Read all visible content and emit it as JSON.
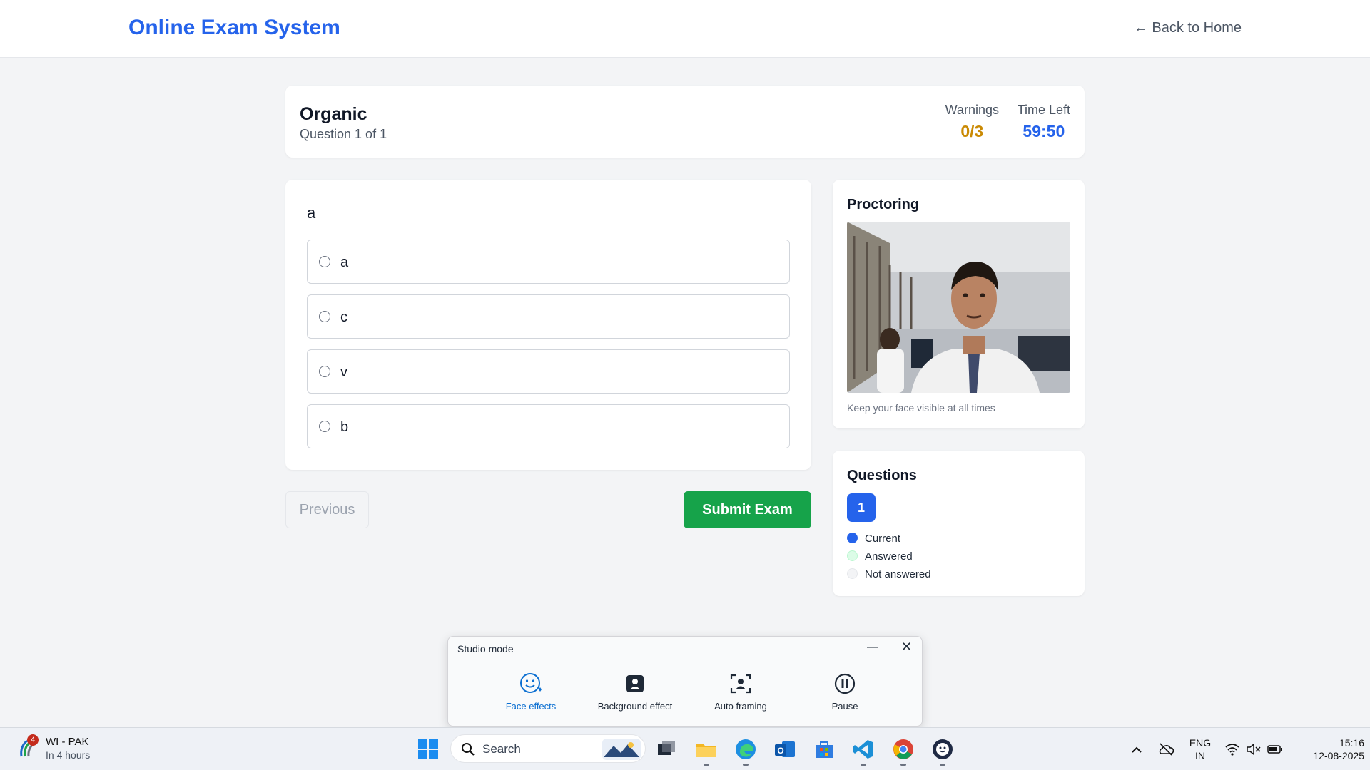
{
  "header": {
    "brand": "Online Exam System",
    "back_link": "← Back to Home"
  },
  "exam": {
    "title": "Organic",
    "progress": "Question 1 of 1",
    "warnings_label": "Warnings",
    "warnings_value": "0/3",
    "time_label": "Time Left",
    "time_value": "59:50"
  },
  "question": {
    "text": "a",
    "options": [
      {
        "label": "a",
        "selected": false
      },
      {
        "label": "c",
        "selected": false
      },
      {
        "label": "v",
        "selected": false
      },
      {
        "label": "b",
        "selected": false
      }
    ]
  },
  "nav": {
    "previous_label": "Previous",
    "submit_label": "Submit Exam"
  },
  "proctoring": {
    "title": "Proctoring",
    "note": "Keep your face visible at all times"
  },
  "questions_panel": {
    "title": "Questions",
    "numbers": [
      "1"
    ],
    "legend": [
      {
        "label": "Current",
        "color": "#2563eb"
      },
      {
        "label": "Answered",
        "color": "#dcfce7"
      },
      {
        "label": "Not answered",
        "color": "#f3f4f6"
      }
    ]
  },
  "studio": {
    "title": "Studio mode",
    "items": [
      {
        "label": "Face effects",
        "icon": "face-effects-icon",
        "active": true
      },
      {
        "label": "Background effect",
        "icon": "background-effect-icon",
        "active": false
      },
      {
        "label": "Auto framing",
        "icon": "auto-framing-icon",
        "active": false
      },
      {
        "label": "Pause",
        "icon": "pause-icon",
        "active": false
      }
    ]
  },
  "taskbar": {
    "weather_badge": "4",
    "weather_title": "WI - PAK",
    "weather_sub": "In 4 hours",
    "search_label": "Search",
    "lang_line1": "ENG",
    "lang_line2": "IN",
    "time": "15:16",
    "date": "12-08-2025"
  },
  "colors": {
    "accent": "#2563eb",
    "warning": "#ca8a04",
    "success": "#16a34a"
  }
}
